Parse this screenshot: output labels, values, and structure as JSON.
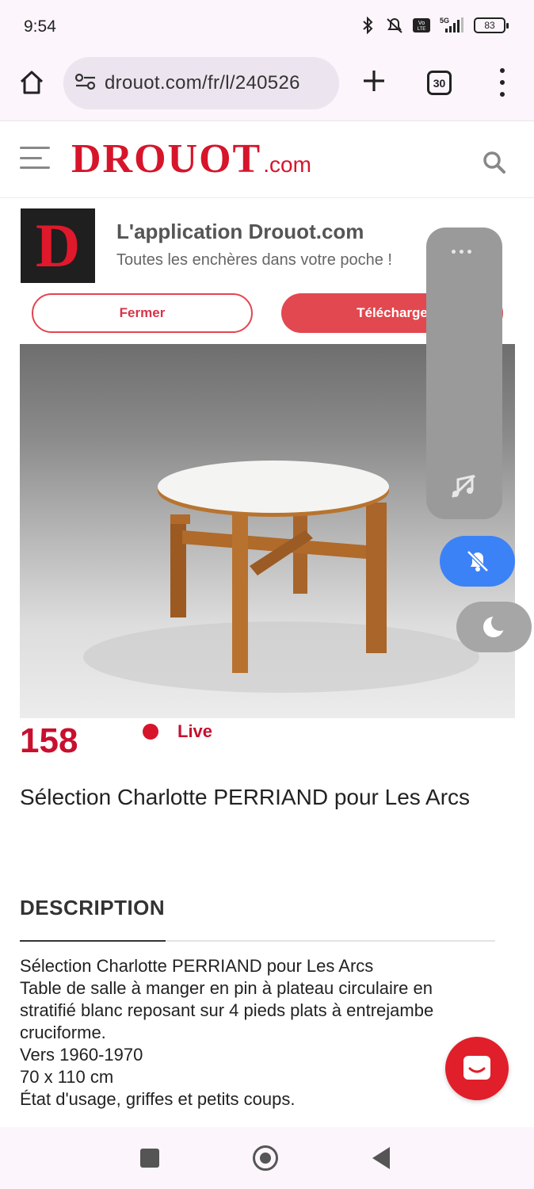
{
  "status_bar": {
    "time": "9:54",
    "battery": "83",
    "network": "5G"
  },
  "browser": {
    "url": "drouot.com/fr/l/240526",
    "tab_count": "30"
  },
  "site": {
    "logo_main": "DROUOT",
    "logo_suffix": ".com"
  },
  "app_banner": {
    "logo_letter": "D",
    "title": "L'application Drouot.com",
    "subtitle": "Toutes les enchères dans votre poche !",
    "close_label": "Fermer",
    "download_label": "Télécharge"
  },
  "lot": {
    "number": "158",
    "status": "Live",
    "title": "Sélection Charlotte PERRIAND pour Les Arcs"
  },
  "description": {
    "heading": "DESCRIPTION",
    "lines": [
      "Sélection Charlotte PERRIAND pour Les Arcs",
      "Table de salle à manger en pin à plateau circulaire en",
      "stratifié blanc reposant sur 4 pieds plats à entrejambe",
      "cruciforme.",
      "Vers 1960-1970",
      "70 x 110 cm",
      "État d'usage, griffes et petits coups."
    ]
  },
  "colors": {
    "brand_red": "#d6152b",
    "button_red": "#e2484f",
    "float_blue": "#3b82f6"
  }
}
